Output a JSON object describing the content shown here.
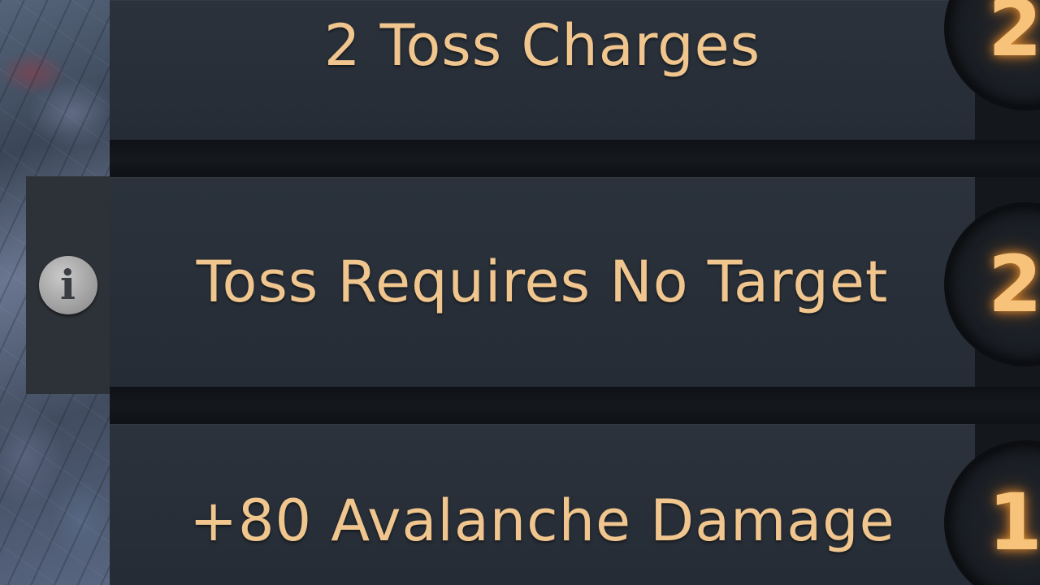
{
  "talents": [
    {
      "label": "2 Toss Charges",
      "level": "2"
    },
    {
      "label": "Toss Requires No Target",
      "level": "2"
    },
    {
      "label": "+80 Avalanche Damage",
      "level": "1"
    }
  ],
  "info_tab": {
    "icon": "info-icon",
    "glyph": "i"
  },
  "colors": {
    "label_text": "#f0c68e",
    "level_glow": "#f7c27a",
    "row_bg": "#2b323c"
  }
}
